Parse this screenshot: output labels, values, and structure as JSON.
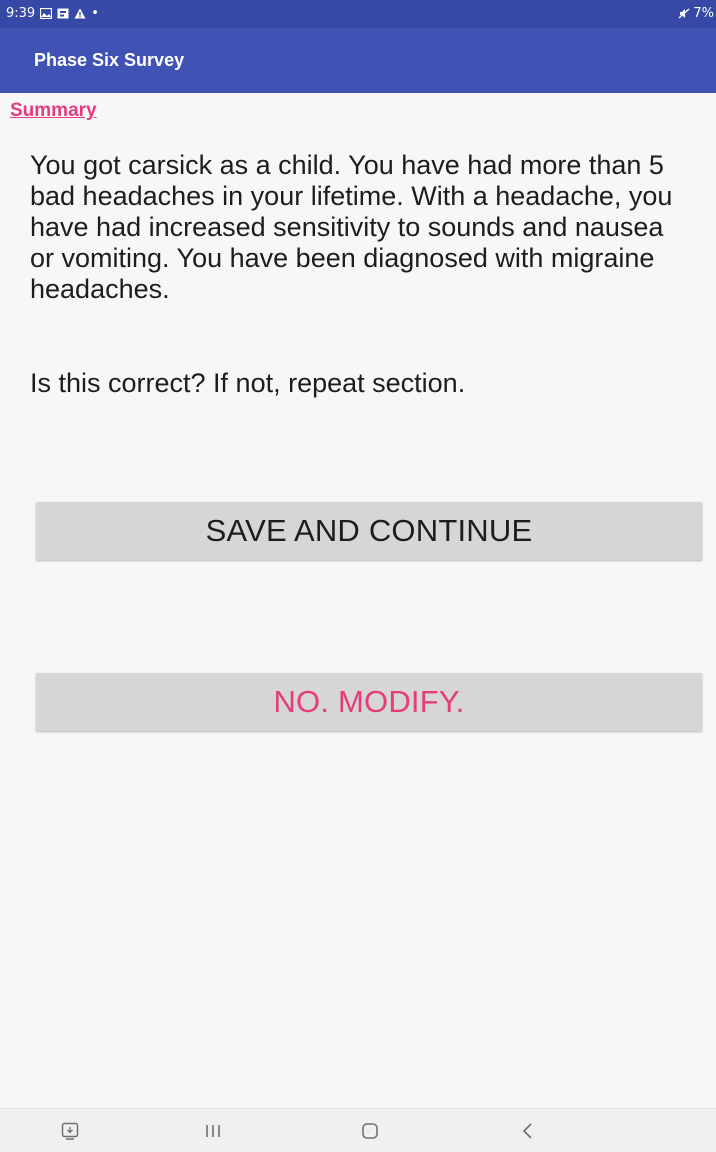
{
  "status_bar": {
    "time": "9:39",
    "left_icons": [
      "gallery-icon",
      "badge-icon",
      "alert-icon",
      "dot-icon"
    ],
    "battery": "7%",
    "right_icons": [
      "mute-icon"
    ]
  },
  "app_bar": {
    "title": "Phase Six Survey"
  },
  "summary": {
    "link_label": "Summary",
    "body": "You got carsick as a child. You have had more than 5 bad headaches in your lifetime. With a headache, you have had increased sensitivity to sounds and nausea or vomiting. You have been diagnosed with migraine headaches.",
    "question": "Is this correct? If not, repeat section."
  },
  "buttons": {
    "save_label": "SAVE AND CONTINUE",
    "modify_label": "NO. MODIFY."
  },
  "colors": {
    "status_bar": "#3649a6",
    "app_bar": "#4053b5",
    "accent": "#e53d7c",
    "button_bg": "#d6d6d6",
    "background": "#f7f7f7"
  },
  "nav_bar": {
    "icons": [
      "recent-apps-icon",
      "home-icon",
      "back-icon",
      "screen-capture-icon"
    ]
  }
}
